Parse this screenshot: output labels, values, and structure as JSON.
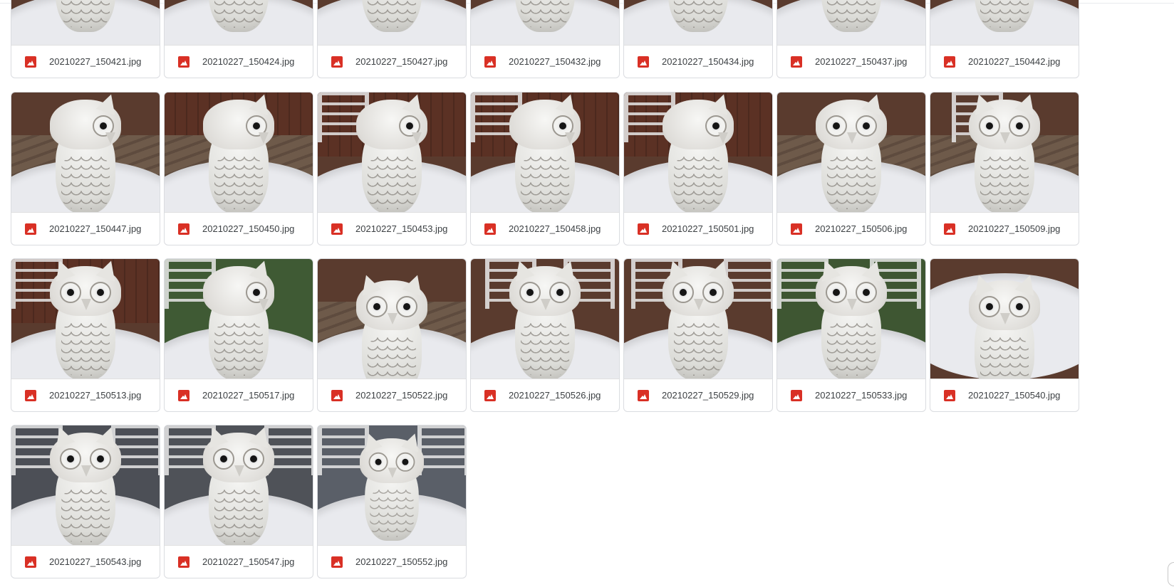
{
  "files": [
    [
      "20210227_150421.jpg",
      "20210227_150424.jpg",
      "20210227_150427.jpg",
      "20210227_150432.jpg",
      "20210227_150434.jpg",
      "20210227_150437.jpg",
      "20210227_150442.jpg"
    ],
    [
      "20210227_150447.jpg",
      "20210227_150450.jpg",
      "20210227_150453.jpg",
      "20210227_150458.jpg",
      "20210227_150501.jpg",
      "20210227_150506.jpg",
      "20210227_150509.jpg"
    ],
    [
      "20210227_150513.jpg",
      "20210227_150517.jpg",
      "20210227_150522.jpg",
      "20210227_150526.jpg",
      "20210227_150529.jpg",
      "20210227_150533.jpg",
      "20210227_150540.jpg"
    ],
    [
      "20210227_150543.jpg",
      "20210227_150547.jpg",
      "20210227_150552.jpg"
    ]
  ],
  "icons": {
    "file_type": "image-file-icon"
  },
  "colors": {
    "file_icon": "#d93025",
    "card_border": "#dadce0",
    "text": "#3c4043"
  }
}
